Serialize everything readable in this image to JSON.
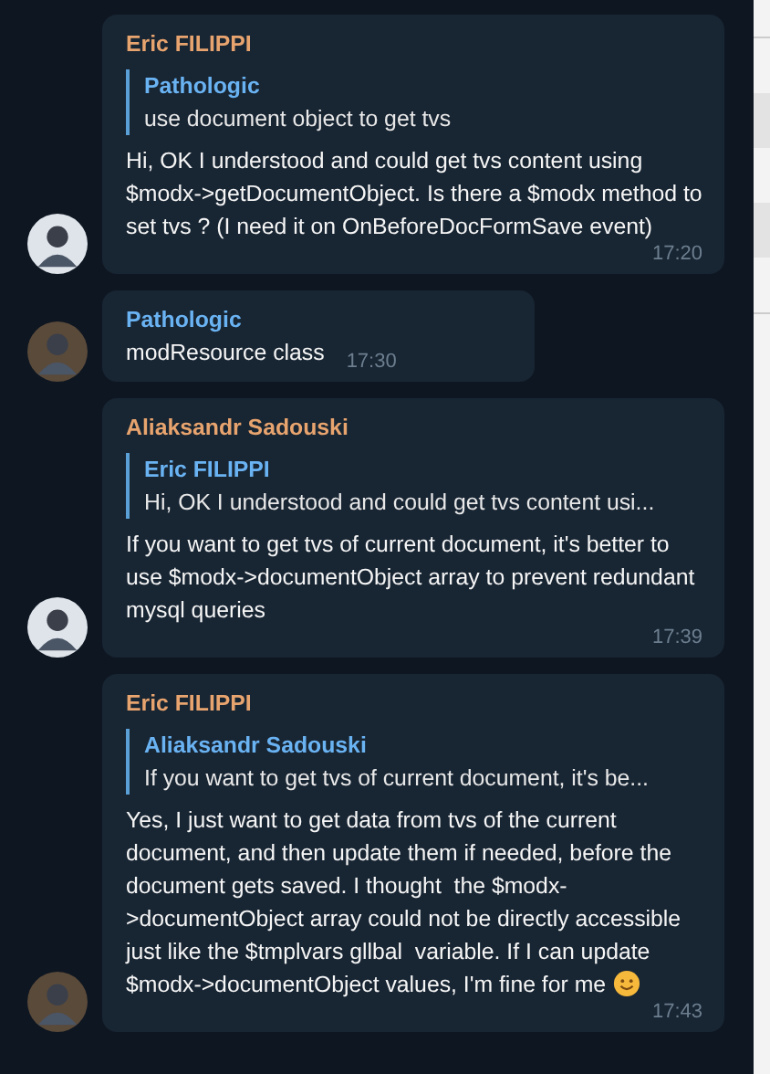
{
  "messages": [
    {
      "author": "Eric FILIPPI",
      "color": "#e8a46e",
      "quote": {
        "author": "Pathologic",
        "text": "use document object to get tvs"
      },
      "text": "Hi, OK I understood and could get tvs content using $modx->getDocumentObject. Is there a $modx method to set tvs ? (I need it on OnBeforeDocFormSave event)",
      "time": "17:20",
      "emoji": false
    },
    {
      "author": "Pathologic",
      "color": "#6ab3f3",
      "text": "modResource class",
      "time": "17:30",
      "emoji": false
    },
    {
      "author": "Aliaksandr Sadouski",
      "color": "#e8a46e",
      "quote": {
        "author": "Eric FILIPPI",
        "text": "Hi, OK I understood and could get tvs content usi..."
      },
      "text": "If you want to get tvs of current document, it's better to use $modx->documentObject array to prevent redundant mysql queries",
      "time": "17:39",
      "emoji": false
    },
    {
      "author": "Eric FILIPPI",
      "color": "#e8a46e",
      "quote": {
        "author": "Aliaksandr Sadouski",
        "text": "If you want to get tvs of current document, it's be..."
      },
      "text": "Yes, I just want to get data from tvs of the current document, and then update them if needed, before the document gets saved. I thought  the $modx->documentObject array could not be directly accessible just like the $tmplvars gllbal  variable. If I can update $modx->documentObject values, I'm fine for me",
      "time": "17:43",
      "emoji": true
    }
  ]
}
